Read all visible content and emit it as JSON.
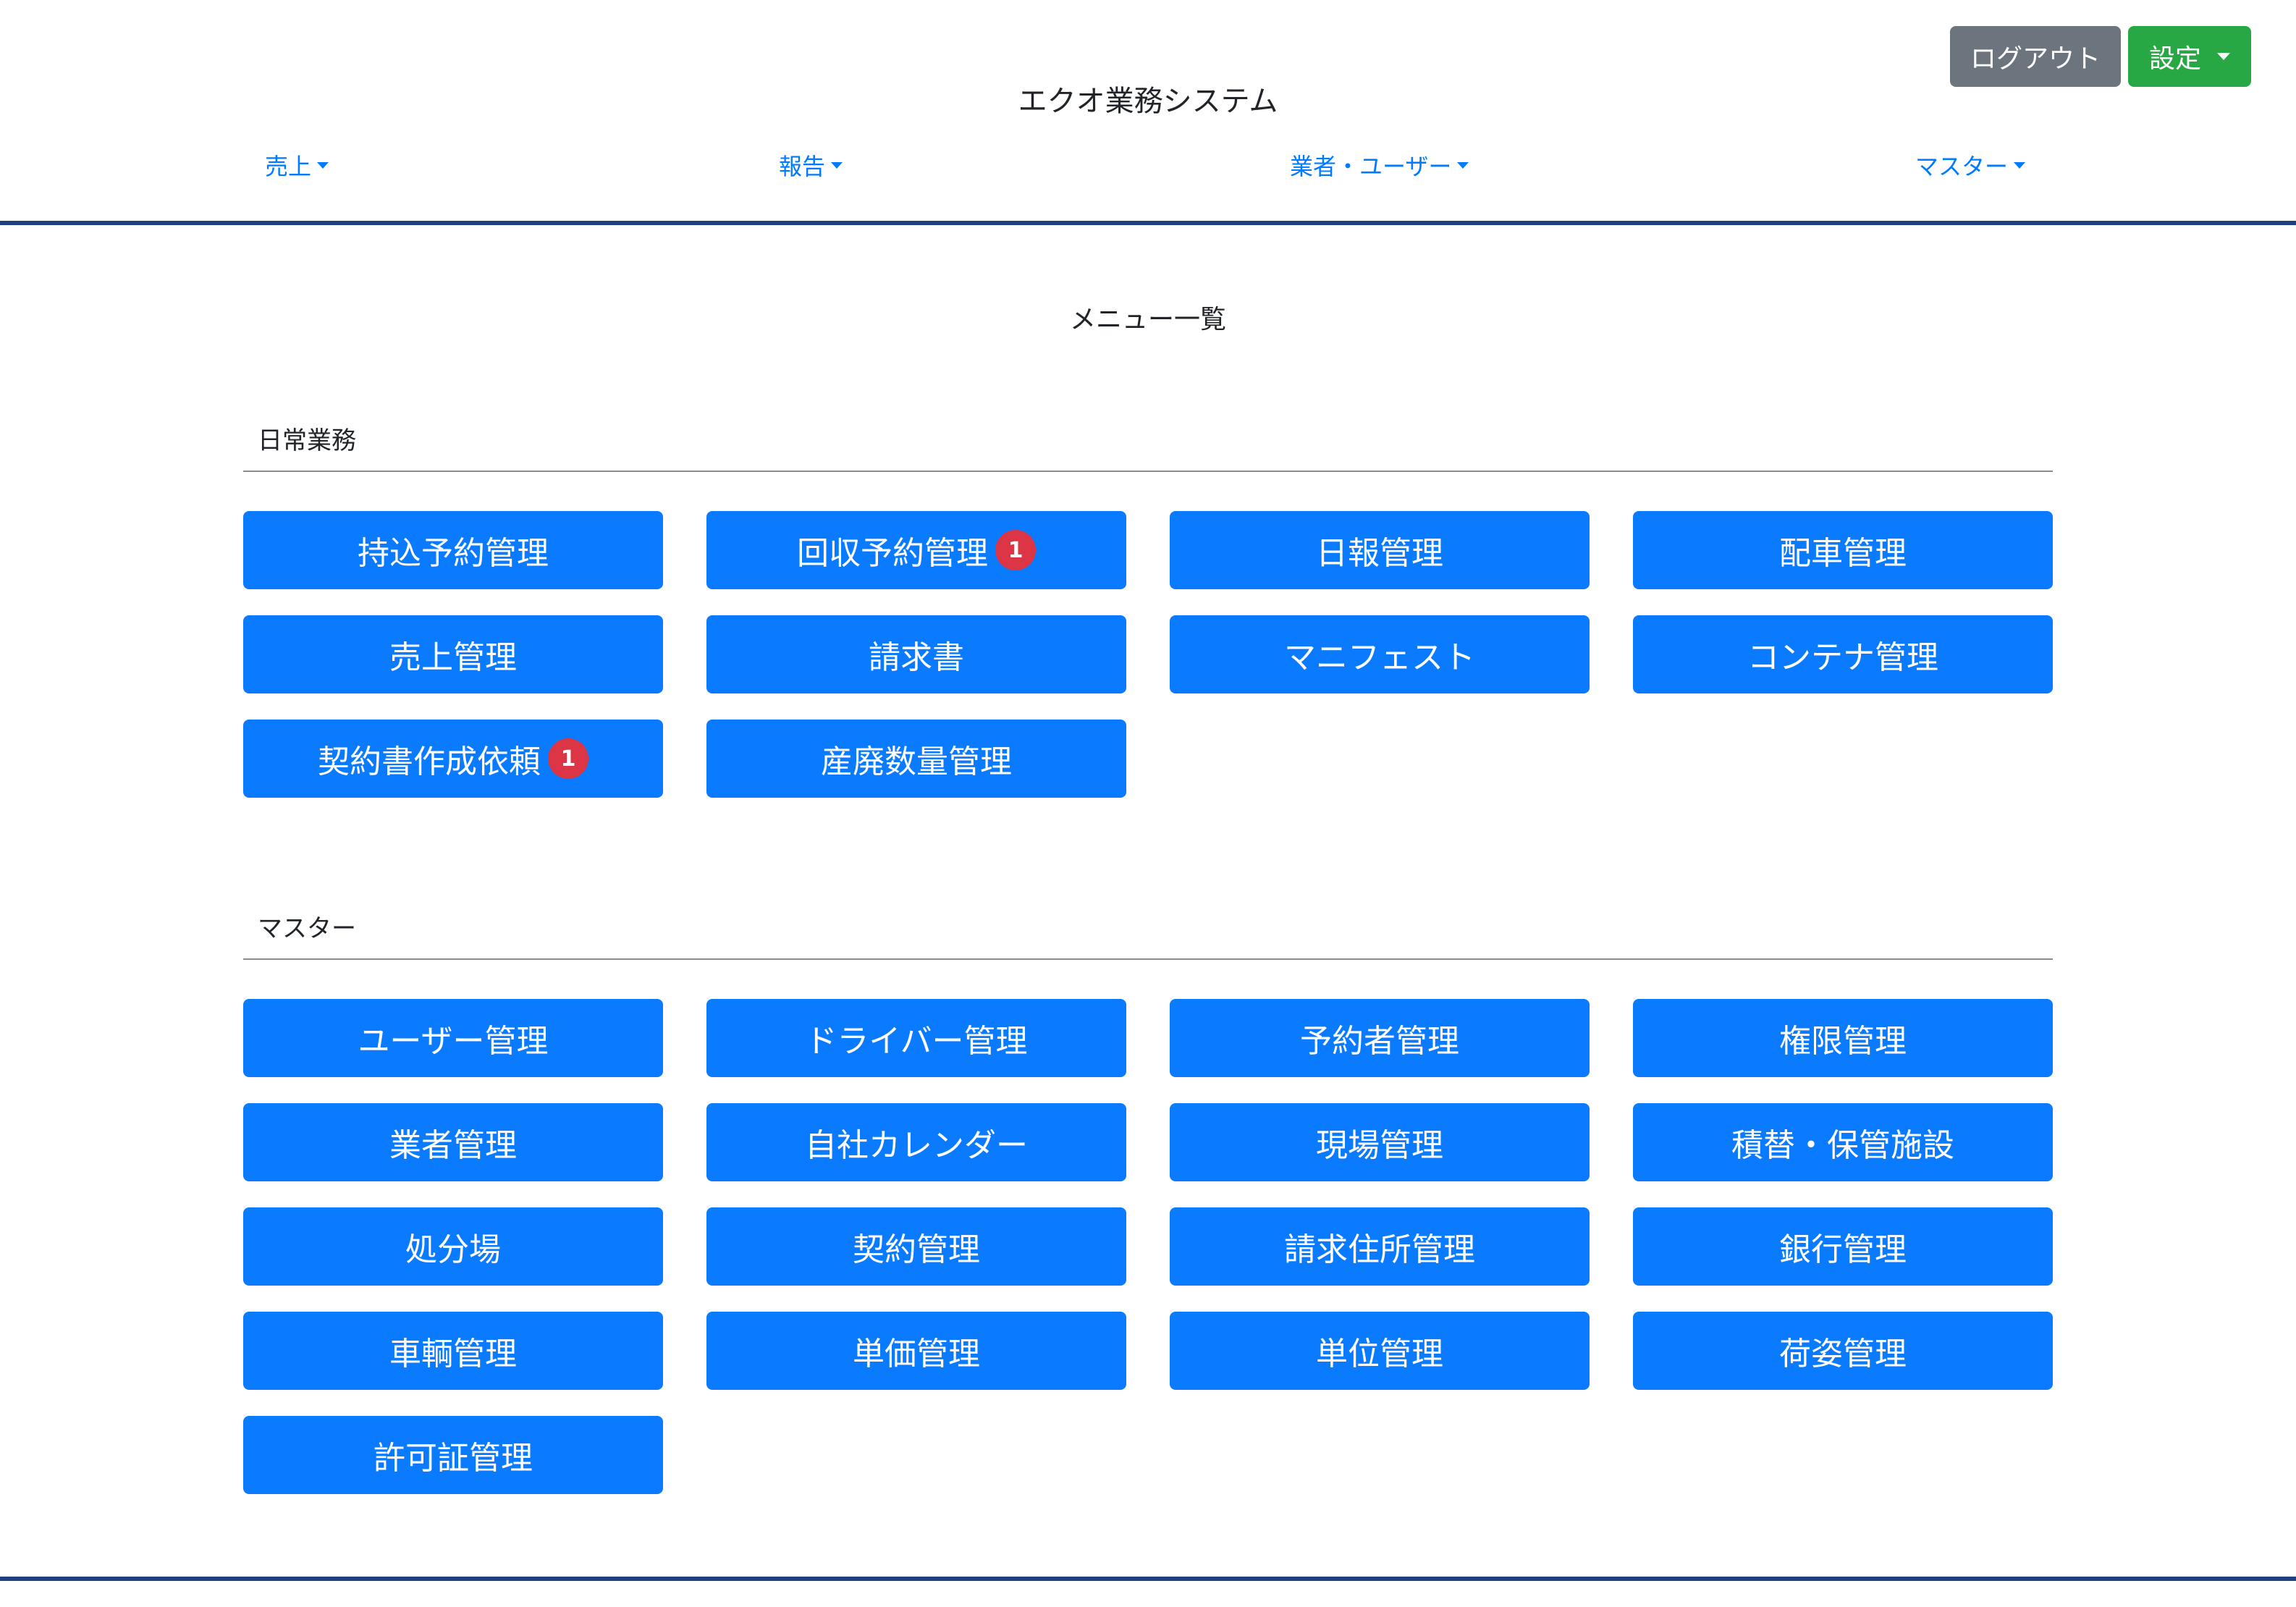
{
  "header": {
    "title": "エクオ業務システム",
    "logout_label": "ログアウト",
    "settings_label": "設定"
  },
  "nav": [
    {
      "label": "売上"
    },
    {
      "label": "報告"
    },
    {
      "label": "業者・ユーザー"
    },
    {
      "label": "マスター"
    }
  ],
  "page": {
    "heading": "メニュー一覧"
  },
  "sections": {
    "daily": {
      "title": "日常業務",
      "buttons": [
        {
          "label": "持込予約管理",
          "badge": ""
        },
        {
          "label": "回収予約管理",
          "badge": "1"
        },
        {
          "label": "日報管理",
          "badge": ""
        },
        {
          "label": "配車管理",
          "badge": ""
        },
        {
          "label": "売上管理",
          "badge": ""
        },
        {
          "label": "請求書",
          "badge": ""
        },
        {
          "label": "マニフェスト",
          "badge": ""
        },
        {
          "label": "コンテナ管理",
          "badge": ""
        },
        {
          "label": "契約書作成依頼",
          "badge": "1"
        },
        {
          "label": "産廃数量管理",
          "badge": ""
        }
      ]
    },
    "master": {
      "title": "マスター",
      "buttons": [
        {
          "label": "ユーザー管理"
        },
        {
          "label": "ドライバー管理"
        },
        {
          "label": "予約者管理"
        },
        {
          "label": "権限管理"
        },
        {
          "label": "業者管理"
        },
        {
          "label": "自社カレンダー"
        },
        {
          "label": "現場管理"
        },
        {
          "label": "積替・保管施設"
        },
        {
          "label": "処分場"
        },
        {
          "label": "契約管理"
        },
        {
          "label": "請求住所管理"
        },
        {
          "label": "銀行管理"
        },
        {
          "label": "車輌管理"
        },
        {
          "label": "単価管理"
        },
        {
          "label": "単位管理"
        },
        {
          "label": "荷姿管理"
        },
        {
          "label": "許可証管理"
        }
      ]
    }
  },
  "colors": {
    "primary": "#0a7bff",
    "success": "#28a745",
    "secondary": "#6c757d",
    "danger": "#dc3545",
    "rule": "#1f3f7f"
  }
}
